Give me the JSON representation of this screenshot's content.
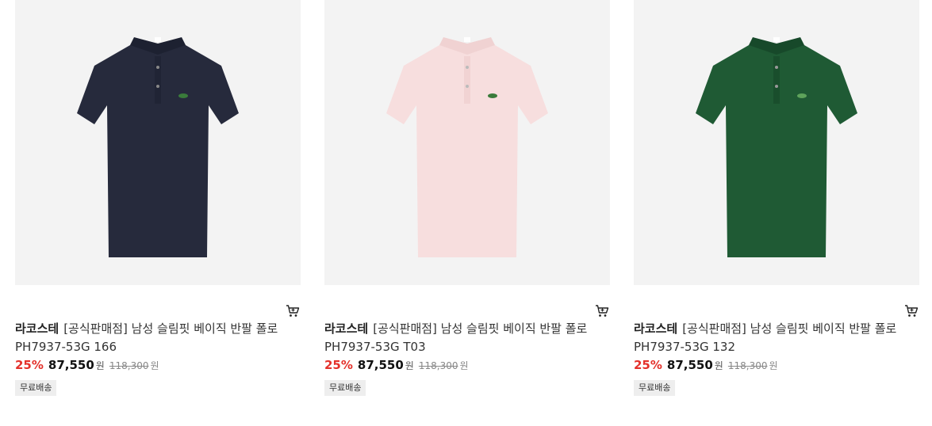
{
  "products": [
    {
      "brand": "라코스테",
      "title": "[공식판매점] 남성 슬림핏 베이직 반팔 폴로",
      "code": "PH7937-53G 166",
      "discount": "25%",
      "price": "87,550",
      "price_unit": "원",
      "original_price": "118,300",
      "original_unit": "원",
      "badge": "무료배송",
      "shirt_color": "#262a3c",
      "collar_color": "#1d2131",
      "shirt_alt": "네이비 폴로 셔츠",
      "cart_icon": "cart-icon"
    },
    {
      "brand": "라코스테",
      "title": "[공식판매점] 남성 슬림핏 베이직 반팔 폴로",
      "code": "PH7937-53G T03",
      "discount": "25%",
      "price": "87,550",
      "price_unit": "원",
      "original_price": "118,300",
      "original_unit": "원",
      "badge": "무료배송",
      "shirt_color": "#f7dede",
      "collar_color": "#f0d2d2",
      "shirt_alt": "핑크 폴로 셔츠",
      "cart_icon": "cart-icon"
    },
    {
      "brand": "라코스테",
      "title": "[공식판매점] 남성 슬림핏 베이직 반팔 폴로",
      "code": "PH7937-53G 132",
      "discount": "25%",
      "price": "87,550",
      "price_unit": "원",
      "original_price": "118,300",
      "original_unit": "원",
      "badge": "무료배송",
      "shirt_color": "#1f5a34",
      "collar_color": "#17492a",
      "shirt_alt": "그린 폴로 셔츠",
      "cart_icon": "cart-icon"
    }
  ],
  "colors": {
    "discount": "#e4312b",
    "image_bg": "#f3f3f3",
    "badge_bg": "#eeeeee"
  }
}
